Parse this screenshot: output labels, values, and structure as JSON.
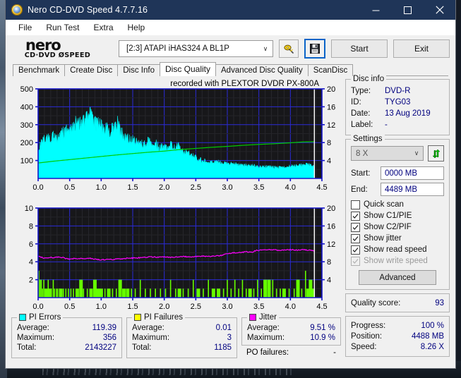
{
  "window": {
    "title": "Nero CD-DVD Speed 4.7.7.16",
    "icon": "nero-disc-icon",
    "minimize": "─",
    "maximize": "□",
    "close": "✕"
  },
  "menu": {
    "items": [
      {
        "label": "File",
        "name": "menu-file"
      },
      {
        "label": "Run Test",
        "name": "menu-run-test"
      },
      {
        "label": "Extra",
        "name": "menu-extra"
      },
      {
        "label": "Help",
        "name": "menu-help"
      }
    ]
  },
  "brand": {
    "name": "nero",
    "tagline": "CD·DVD ØSPEED"
  },
  "toolbar": {
    "device": "[2:3]  ATAPI iHAS324   A BL1P",
    "device_caret": "∨",
    "scan_icon": "scan-disc-icon",
    "save_icon": "floppy-save-icon",
    "start_label": "Start",
    "exit_label": "Exit"
  },
  "tabs": [
    {
      "label": "Benchmark",
      "name": "tab-benchmark",
      "active": false
    },
    {
      "label": "Create Disc",
      "name": "tab-create-disc",
      "active": false
    },
    {
      "label": "Disc Info",
      "name": "tab-disc-info",
      "active": false
    },
    {
      "label": "Disc Quality",
      "name": "tab-disc-quality",
      "active": true
    },
    {
      "label": "Advanced Disc Quality",
      "name": "tab-advanced-disc-quality",
      "active": false
    },
    {
      "label": "ScanDisc",
      "name": "tab-scandisc",
      "active": false
    }
  ],
  "chart_data": [
    {
      "type": "area",
      "name": "pi-errors-graph",
      "title": "recorded with PLEXTOR  DVDR   PX-800A",
      "xlabel": "",
      "ylabel": "",
      "xlim": [
        0.0,
        4.5
      ],
      "ylim": [
        0,
        500
      ],
      "y2lim": [
        0,
        20
      ],
      "grid": true,
      "xticks": [
        "0.0",
        "0.5",
        "1.0",
        "1.5",
        "2.0",
        "2.5",
        "3.0",
        "3.5",
        "4.0",
        "4.5"
      ],
      "yticks": [
        "100",
        "200",
        "300",
        "400",
        "500"
      ],
      "y2ticks": [
        "4",
        "8",
        "12",
        "16",
        "20"
      ],
      "series": [
        {
          "name": "PI Errors",
          "color": "#00ffff",
          "style": "area",
          "x": [
            0.0,
            0.03,
            0.06,
            0.09,
            0.12,
            0.15,
            0.18,
            0.21,
            0.24,
            0.27,
            0.3,
            0.33,
            0.36,
            0.39,
            0.42,
            0.45,
            0.48,
            0.51,
            0.54,
            0.57,
            0.6,
            0.63,
            0.66,
            0.69,
            0.72,
            0.75,
            0.78,
            0.81,
            0.84,
            0.87,
            0.9,
            0.93,
            0.96,
            0.99,
            1.02,
            1.05,
            1.08,
            1.11,
            1.14,
            1.17,
            1.2,
            1.23,
            1.26,
            1.29,
            1.32,
            1.35,
            1.38,
            1.41,
            1.44,
            1.47,
            1.5,
            1.56,
            1.62,
            1.68,
            1.74,
            1.8,
            1.86,
            1.92,
            1.98,
            2.04,
            2.1,
            2.16,
            2.22,
            2.28,
            2.34,
            2.4,
            2.46,
            2.52,
            2.58,
            2.64,
            2.7,
            2.76,
            2.82,
            2.88,
            2.94,
            3.0,
            3.1,
            3.2,
            3.3,
            3.4,
            3.5,
            3.6,
            3.7,
            3.8,
            3.9,
            4.0,
            4.1,
            4.2,
            4.3,
            4.38
          ],
          "y": [
            115,
            175,
            205,
            215,
            220,
            212,
            225,
            218,
            230,
            226,
            222,
            218,
            238,
            245,
            250,
            262,
            270,
            258,
            282,
            292,
            300,
            288,
            310,
            318,
            300,
            325,
            340,
            355,
            335,
            320,
            300,
            292,
            310,
            288,
            272,
            266,
            280,
            258,
            250,
            272,
            262,
            280,
            298,
            278,
            256,
            240,
            232,
            224,
            218,
            212,
            205,
            198,
            190,
            186,
            205,
            178,
            196,
            170,
            168,
            162,
            188,
            166,
            176,
            148,
            140,
            132,
            120,
            110,
            100,
            95,
            90,
            86,
            88,
            92,
            84,
            80,
            78,
            74,
            72,
            70,
            66,
            64,
            62,
            60,
            62,
            66,
            70,
            72,
            76,
            62
          ]
        },
        {
          "name": "Read speed",
          "color": "#00cc00",
          "style": "line",
          "axis": "right",
          "x": [
            0.0,
            0.25,
            0.5,
            0.75,
            1.0,
            1.25,
            1.5,
            1.75,
            2.0,
            2.25,
            2.5,
            2.75,
            3.0,
            3.25,
            3.5,
            3.75,
            4.0,
            4.2,
            4.38
          ],
          "y": [
            3.45,
            3.85,
            4.2,
            4.55,
            4.9,
            5.25,
            5.55,
            5.85,
            6.1,
            6.45,
            6.7,
            6.95,
            7.15,
            7.4,
            7.6,
            7.75,
            7.95,
            8.15,
            8.2
          ]
        }
      ]
    },
    {
      "type": "line",
      "name": "pif-jitter-graph",
      "title": "",
      "xlabel": "",
      "ylabel": "",
      "xlim": [
        0.0,
        4.5
      ],
      "ylim": [
        0,
        10
      ],
      "y2lim": [
        0,
        20
      ],
      "grid": true,
      "xticks": [
        "0.0",
        "0.5",
        "1.0",
        "1.5",
        "2.0",
        "2.5",
        "3.0",
        "3.5",
        "4.0",
        "4.5"
      ],
      "yticks": [
        "2",
        "4",
        "6",
        "8",
        "10"
      ],
      "y2ticks": [
        "4",
        "8",
        "12",
        "16",
        "20"
      ],
      "series": [
        {
          "name": "Jitter",
          "color": "#ff00ff",
          "style": "line",
          "axis": "right",
          "x": [
            0.0,
            0.05,
            0.1,
            0.15,
            0.2,
            0.25,
            0.3,
            0.35,
            0.4,
            0.45,
            0.5,
            0.55,
            0.6,
            0.65,
            0.7,
            0.75,
            0.8,
            0.85,
            0.9,
            0.95,
            1.0,
            1.05,
            1.1,
            1.15,
            1.2,
            1.25,
            1.3,
            1.35,
            1.4,
            1.45,
            1.5,
            1.6,
            1.7,
            1.8,
            1.9,
            2.0,
            2.1,
            2.2,
            2.3,
            2.4,
            2.5,
            2.6,
            2.7,
            2.8,
            2.9,
            2.95,
            3.0,
            3.05,
            3.1,
            3.2,
            3.3,
            3.4,
            3.45,
            3.5,
            3.6,
            3.7,
            3.8,
            3.9,
            4.0,
            4.1,
            4.2,
            4.3,
            4.38
          ],
          "y": [
            9.3,
            9.0,
            8.8,
            8.9,
            9.0,
            8.9,
            9.1,
            9.0,
            8.9,
            8.7,
            8.6,
            8.7,
            8.8,
            8.7,
            8.8,
            8.7,
            8.8,
            8.7,
            8.6,
            8.5,
            8.4,
            8.5,
            8.5,
            8.6,
            8.5,
            8.7,
            8.6,
            8.7,
            8.8,
            8.9,
            8.8,
            8.9,
            9.0,
            9.1,
            9.0,
            9.1,
            9.0,
            9.1,
            9.2,
            9.1,
            9.2,
            9.3,
            9.2,
            9.3,
            9.4,
            9.6,
            9.8,
            9.9,
            10.0,
            10.1,
            10.2,
            10.2,
            10.5,
            10.6,
            10.6,
            10.7,
            10.6,
            10.6,
            10.7,
            10.6,
            10.7,
            10.6,
            10.5
          ]
        },
        {
          "name": "PI Failures",
          "color": "#66ff00",
          "style": "bars",
          "x": [
            0.01,
            0.03,
            0.05,
            0.07,
            0.09,
            0.11,
            0.14,
            0.16,
            0.19,
            0.21,
            0.24,
            0.26,
            0.29,
            0.31,
            0.34,
            0.36,
            0.4,
            0.44,
            0.48,
            0.52,
            0.56,
            0.62,
            0.68,
            0.72,
            0.78,
            0.84,
            0.9,
            0.95,
            1.0,
            1.06,
            1.12,
            1.18,
            1.24,
            1.3,
            1.36,
            1.42,
            1.48,
            1.54,
            1.62,
            1.7,
            1.78,
            1.86,
            1.94,
            2.02,
            2.1,
            2.18,
            2.24,
            2.3,
            2.38,
            2.46,
            2.54,
            2.62,
            2.7,
            2.78,
            2.86,
            2.94,
            3.0,
            3.06,
            3.12,
            3.18,
            3.24,
            3.3,
            3.36,
            3.42,
            3.48,
            3.54,
            3.6,
            3.66,
            3.72,
            3.78,
            3.84,
            3.9,
            3.98,
            4.06,
            4.12,
            4.18,
            4.24,
            4.28,
            4.32,
            4.36
          ],
          "y": [
            3,
            2,
            2,
            1,
            2,
            1,
            1,
            2,
            1,
            1,
            2,
            1,
            1,
            1,
            1,
            1,
            1,
            1,
            1,
            1,
            1,
            1,
            2,
            1,
            1,
            1,
            2,
            1,
            1,
            1,
            1,
            1,
            1,
            2,
            1,
            1,
            1,
            1,
            2,
            1,
            1,
            1,
            1,
            1,
            2,
            1,
            1,
            1,
            1,
            2,
            1,
            1,
            2,
            1,
            1,
            1,
            2,
            1,
            2,
            1,
            2,
            1,
            1,
            1,
            2,
            1,
            2,
            2,
            2,
            1,
            1,
            1,
            1,
            1,
            2,
            1,
            3,
            1,
            2,
            1
          ]
        }
      ]
    }
  ],
  "stats": {
    "pi_errors": {
      "title": "PI Errors",
      "color": "#00ffff",
      "rows": [
        {
          "label": "Average:",
          "value": "119.39"
        },
        {
          "label": "Maximum:",
          "value": "356"
        },
        {
          "label": "Total:",
          "value": "2143227"
        }
      ]
    },
    "pi_failures": {
      "title": "PI Failures",
      "color": "#ffff00",
      "rows": [
        {
          "label": "Average:",
          "value": "0.01"
        },
        {
          "label": "Maximum:",
          "value": "3"
        },
        {
          "label": "Total:",
          "value": "1185"
        }
      ]
    },
    "jitter": {
      "title": "Jitter",
      "color": "#ff00ff",
      "rows": [
        {
          "label": "Average:",
          "value": "9.51 %"
        },
        {
          "label": "Maximum:",
          "value": "10.9 %"
        }
      ],
      "po_label": "PO failures:",
      "po_value": "-"
    }
  },
  "disc_info": {
    "title": "Disc info",
    "rows": [
      {
        "label": "Type:",
        "value": "DVD-R"
      },
      {
        "label": "ID:",
        "value": "TYG03"
      },
      {
        "label": "Date:",
        "value": "13 Aug 2019"
      },
      {
        "label": "Label:",
        "value": "-"
      }
    ]
  },
  "settings": {
    "title": "Settings",
    "speed": "8 X",
    "speed_caret": "∨",
    "refresh_icon": "refresh-arrows-icon",
    "start_label": "Start:",
    "start_value": "0000 MB",
    "end_label": "End:",
    "end_value": "4489 MB",
    "checkboxes": [
      {
        "label": "Quick scan",
        "checked": false,
        "disabled": false,
        "name": "checkbox-quick-scan"
      },
      {
        "label": "Show C1/PIE",
        "checked": true,
        "disabled": false,
        "name": "checkbox-show-c1-pie"
      },
      {
        "label": "Show C2/PIF",
        "checked": true,
        "disabled": false,
        "name": "checkbox-show-c2-pif"
      },
      {
        "label": "Show jitter",
        "checked": true,
        "disabled": false,
        "name": "checkbox-show-jitter"
      },
      {
        "label": "Show read speed",
        "checked": true,
        "disabled": false,
        "name": "checkbox-show-read-speed"
      },
      {
        "label": "Show write speed",
        "checked": true,
        "disabled": true,
        "name": "checkbox-show-write-speed"
      }
    ],
    "advanced_label": "Advanced"
  },
  "quality": {
    "label": "Quality score:",
    "value": "93"
  },
  "progress": {
    "rows": [
      {
        "label": "Progress:",
        "value": "100 %"
      },
      {
        "label": "Position:",
        "value": "4488 MB"
      },
      {
        "label": "Speed:",
        "value": "8.26 X"
      }
    ]
  }
}
